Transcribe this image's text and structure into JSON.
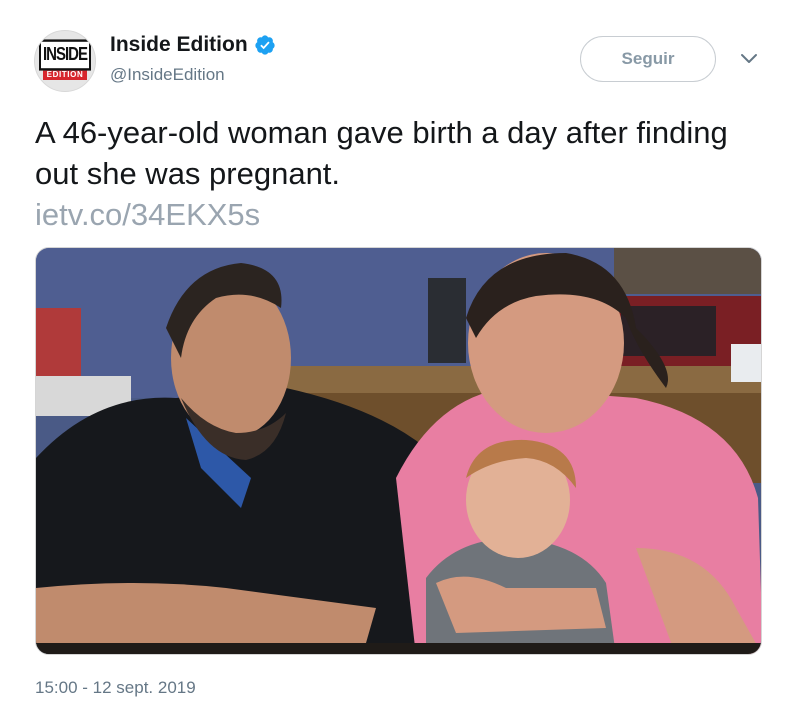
{
  "user": {
    "display_name": "Inside Edition",
    "handle": "@InsideEdition",
    "verified": true,
    "logo_text_top": "INSIDE",
    "logo_text_bottom": "EDITION",
    "verified_color": "#1da1f2"
  },
  "actions": {
    "follow_label": "Seguir",
    "more_icon": "chevron-down-icon"
  },
  "tweet": {
    "text": "A 46-year-old woman gave birth a day after finding out she was pregnant.",
    "link": "ietv.co/34EKX5s",
    "timestamp": "15:00 - 12 sept. 2019"
  },
  "media": {
    "type": "photo"
  },
  "colors": {
    "text": "#14171a",
    "secondary": "#657786",
    "link_gray": "#9aa5b0",
    "brand_red": "#d7262d"
  }
}
